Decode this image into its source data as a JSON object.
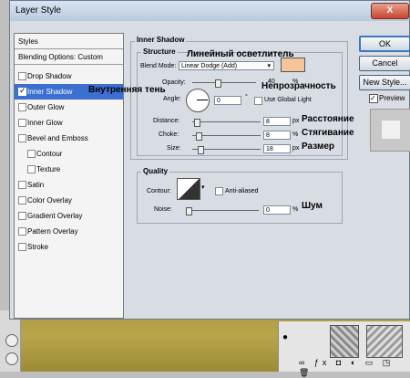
{
  "dialog": {
    "title": "Layer Style",
    "close_label": "X"
  },
  "style_list": {
    "header": "Styles",
    "blending": "Blending Options: Custom",
    "items": [
      {
        "label": "Drop Shadow",
        "checked": false
      },
      {
        "label": "Inner Shadow",
        "checked": true
      },
      {
        "label": "Outer Glow",
        "checked": false
      },
      {
        "label": "Inner Glow",
        "checked": false
      },
      {
        "label": "Bevel and Emboss",
        "checked": false
      },
      {
        "label": "Contour",
        "checked": false
      },
      {
        "label": "Texture",
        "checked": false
      },
      {
        "label": "Satin",
        "checked": false
      },
      {
        "label": "Color Overlay",
        "checked": false
      },
      {
        "label": "Gradient Overlay",
        "checked": false
      },
      {
        "label": "Pattern Overlay",
        "checked": false
      },
      {
        "label": "Stroke",
        "checked": false
      }
    ]
  },
  "inner_shadow": {
    "title": "Inner Shadow",
    "structure": "Structure",
    "blend_mode_label": "Blend Mode:",
    "blend_mode_value": "Linear Dodge (Add)",
    "color": "#f4c49a",
    "opacity_label": "Opacity:",
    "opacity_value": "40",
    "opacity_unit": "%",
    "angle_label": "Angle:",
    "angle_value": "0",
    "angle_unit": "°",
    "global_light": "Use Global Light",
    "distance_label": "Distance:",
    "distance_value": "8",
    "distance_unit": "px",
    "choke_label": "Choke:",
    "choke_value": "8",
    "choke_unit": "%",
    "size_label": "Size:",
    "size_value": "18",
    "size_unit": "px"
  },
  "quality": {
    "title": "Quality",
    "contour_label": "Contour:",
    "anti_aliased": "Anti-aliased",
    "noise_label": "Noise:",
    "noise_value": "0",
    "noise_unit": "%"
  },
  "annotations": {
    "linear_dodge": "Линейный осветлитель",
    "opacity": "Непрозрачность",
    "inner_shadow": "Внутренняя тень",
    "distance": "Расстояние",
    "choke": "Стягивание",
    "size": "Размер",
    "noise": "Шум"
  },
  "buttons": {
    "ok": "OK",
    "cancel": "Cancel",
    "new_style": "New Style...",
    "preview": "Preview"
  }
}
